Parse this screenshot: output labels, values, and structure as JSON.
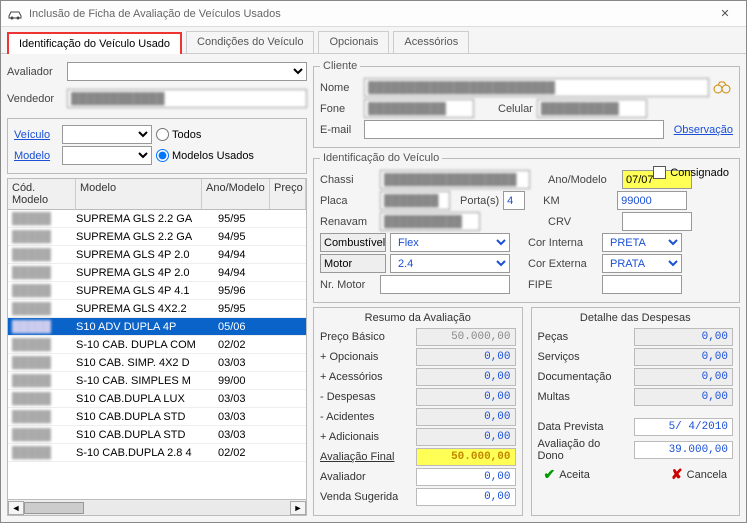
{
  "window": {
    "title": "Inclusão de Ficha de Avaliação de Veículos Usados"
  },
  "tabs": {
    "t1": "Identificação do Veículo Usado",
    "t2": "Condições do Veículo",
    "t3": "Opcionais",
    "t4": "Acessórios"
  },
  "top": {
    "avaliador_lbl": "Avaliador",
    "avaliador_val": "",
    "vendedor_lbl": "Vendedor",
    "vendedor_val": ""
  },
  "filter": {
    "veiculo_link": "Veículo",
    "veiculo_val": "",
    "modelo_link": "Modelo",
    "modelo_val": "",
    "todos": "Todos",
    "usados": "Modelos Usados"
  },
  "grid": {
    "h_cod": "Cód. Modelo",
    "h_mod": "Modelo",
    "h_ano": "Ano/Modelo",
    "h_prec": "Preço",
    "rows": [
      {
        "cod": "█████",
        "mod": "SUPREMA GLS 2.2 GA",
        "ano": "95/95"
      },
      {
        "cod": "█████",
        "mod": "SUPREMA GLS 2.2 GA",
        "ano": "94/95"
      },
      {
        "cod": "█████",
        "mod": "SUPREMA GLS 4P 2.0",
        "ano": "94/94"
      },
      {
        "cod": "█████",
        "mod": "SUPREMA GLS 4P 2.0",
        "ano": "94/94"
      },
      {
        "cod": "█████",
        "mod": "SUPREMA GLS 4P 4.1",
        "ano": "95/96"
      },
      {
        "cod": "█████",
        "mod": "SUPREMA GLS 4X2.2",
        "ano": "95/95"
      },
      {
        "cod": "█████",
        "mod": "S10 ADV DUPLA 4P",
        "ano": "05/06",
        "sel": true
      },
      {
        "cod": "█████",
        "mod": "S-10 CAB. DUPLA COM",
        "ano": "02/02"
      },
      {
        "cod": "█████",
        "mod": "S10 CAB. SIMP. 4X2 D",
        "ano": "03/03"
      },
      {
        "cod": "█████",
        "mod": "S-10 CAB. SIMPLES M",
        "ano": "99/00"
      },
      {
        "cod": "█████",
        "mod": "S10 CAB.DUPLA LUX",
        "ano": "03/03"
      },
      {
        "cod": "█████",
        "mod": "S10 CAB.DUPLA STD",
        "ano": "03/03"
      },
      {
        "cod": "█████",
        "mod": "S10 CAB.DUPLA STD",
        "ano": "03/03"
      },
      {
        "cod": "█████",
        "mod": "S-10 CAB.DUPLA 2.8 4",
        "ano": "02/02"
      }
    ]
  },
  "cliente": {
    "legend": "Cliente",
    "nome_lbl": "Nome",
    "nome_val": "████████████████████████",
    "fone_lbl": "Fone",
    "fone_val": "██████████",
    "cel_lbl": "Celular",
    "cel_val": "██████████",
    "email_lbl": "E-mail",
    "email_val": "",
    "obs": "Observação"
  },
  "idv": {
    "legend": "Identificação do Veículo",
    "consignado": "Consignado",
    "chassi_lbl": "Chassi",
    "chassi_val": "█████████████████",
    "placa_lbl": "Placa",
    "placa_val": "███████",
    "portas_lbl": "Porta(s)",
    "portas_val": "4",
    "renavam_lbl": "Renavam",
    "renavam_val": "██████████",
    "ano_lbl": "Ano/Modelo",
    "ano_val": "07/07",
    "km_lbl": "KM",
    "km_val": "99000",
    "crv_lbl": "CRV",
    "crv_val": "",
    "combustivel_lbl": "Combustível",
    "combustivel_val": "Flex",
    "corint_lbl": "Cor Interna",
    "corint_val": "PRETA",
    "motor_lbl": "Motor",
    "motor_val": "2.4",
    "corext_lbl": "Cor Externa",
    "corext_val": "PRATA",
    "nrmotor_lbl": "Nr. Motor",
    "nrmotor_val": "",
    "fipe_lbl": "FIPE",
    "fipe_val": ""
  },
  "resumo": {
    "title": "Resumo da Avaliação",
    "rows": [
      {
        "lbl": "Preço Básico",
        "val": "50.000,00",
        "gray": true
      },
      {
        "lbl": "+ Opcionais",
        "val": "0,00"
      },
      {
        "lbl": "+ Acessórios",
        "val": "0,00"
      },
      {
        "lbl": "- Despesas",
        "val": "0,00"
      },
      {
        "lbl": "- Acidentes",
        "val": "0,00"
      },
      {
        "lbl": "+ Adicionais",
        "val": "0,00"
      },
      {
        "lbl": "Avaliação Final",
        "val": "50.000,00",
        "yellow": true,
        "under": true
      },
      {
        "lbl": "Avaliador",
        "val": "0,00",
        "plain": true
      },
      {
        "lbl": "Venda Sugerida",
        "val": "0,00",
        "plain": true
      }
    ]
  },
  "detalhe": {
    "title": "Detalhe das Despesas",
    "rows": [
      {
        "lbl": "Peças",
        "val": "0,00"
      },
      {
        "lbl": "Serviços",
        "val": "0,00"
      },
      {
        "lbl": "Documentação",
        "val": "0,00"
      },
      {
        "lbl": "Multas",
        "val": "0,00"
      }
    ],
    "data_lbl": "Data Prevista",
    "data_val": "5/ 4/2010",
    "avdono_lbl": "Avaliação do Dono",
    "avdono_val": "39.000,00"
  },
  "actions": {
    "aceita": "Aceita",
    "cancela": "Cancela"
  }
}
